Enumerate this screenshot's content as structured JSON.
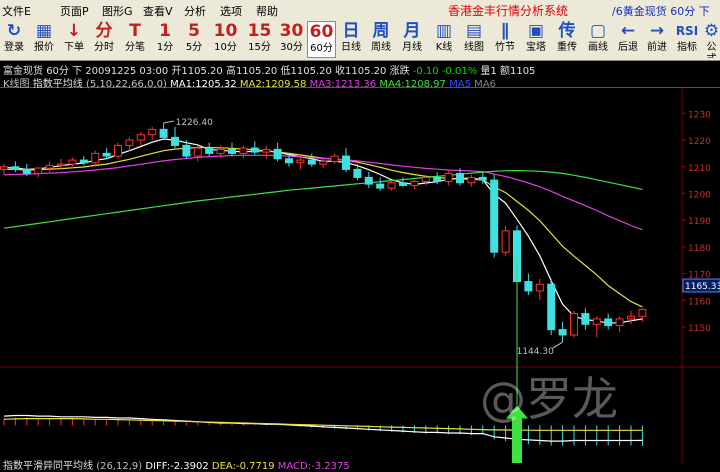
{
  "menu": {
    "items": [
      "文件E",
      "页面P",
      "图形G",
      "查看V",
      "分析",
      "选项",
      "帮助"
    ],
    "title": "香港金丰行情分析系统",
    "sub": "/6黄金现货 60分 下"
  },
  "toolbar": {
    "buttons": [
      {
        "glyph": "↻",
        "label": "登录"
      },
      {
        "glyph": "▦",
        "label": "报价"
      },
      {
        "glyph": "↓",
        "label": "下单"
      },
      {
        "glyph": "分",
        "label": "分时"
      },
      {
        "glyph": "T",
        "label": "分笔"
      },
      {
        "glyph": "1",
        "label": "1分"
      },
      {
        "glyph": "5",
        "label": "5分"
      },
      {
        "glyph": "10",
        "label": "10分"
      },
      {
        "glyph": "15",
        "label": "15分"
      },
      {
        "glyph": "30",
        "label": "30分"
      },
      {
        "glyph": "60",
        "label": "60分"
      },
      {
        "glyph": "日",
        "label": "日线"
      },
      {
        "glyph": "周",
        "label": "周线"
      },
      {
        "glyph": "月",
        "label": "月线"
      },
      {
        "glyph": "▥",
        "label": "K线"
      },
      {
        "glyph": "▤",
        "label": "线图"
      },
      {
        "glyph": "∥",
        "label": "竹节"
      },
      {
        "glyph": "▣",
        "label": "宝塔"
      },
      {
        "glyph": "传",
        "label": "重传"
      },
      {
        "glyph": "▢",
        "label": "画线"
      },
      {
        "glyph": "←",
        "label": "后退"
      },
      {
        "glyph": "→",
        "label": "前进"
      },
      {
        "glyph": "RSI",
        "label": "指标"
      },
      {
        "glyph": "⚙",
        "label": "公式"
      }
    ],
    "active_index": 10
  },
  "quote": {
    "symbol": "富金现货",
    "period": "60分",
    "direction": "下",
    "datetime": "20091225 03:00",
    "open_label": "开",
    "open": "1105.20",
    "high_label": "高",
    "high": "1105.20",
    "low_label": "低",
    "low": "1105.20",
    "close_label": "收",
    "close": "1105.20",
    "change_label": "涨跌",
    "change": "-0.10",
    "pct": "-0.01%",
    "vol_label": "量",
    "vol": "1",
    "amount_label": "额",
    "amount": "1105"
  },
  "ma_header": {
    "tab": "K线图",
    "indicator": "指数平均线",
    "params": "(5,10,22,66,0,0)",
    "ma1": "MA1:1205.32",
    "ma2": "MA2:1209.58",
    "ma3": "MA3:1213.36",
    "ma4": "MA4:1208.97",
    "ma5": "MA5",
    "ma6": "MA6"
  },
  "macd_header": {
    "name": "指数平滑异同平均线",
    "params": "(26,12,9)",
    "diff": "DIFF:-2.3902",
    "dea": "DEA:-0.7719",
    "macd": "MACD:-3.2375"
  },
  "colors": {
    "ma1": "#ffffff",
    "ma2": "#e8e040",
    "ma3": "#e040e0",
    "ma4": "#40e040",
    "ma5": "#0000ff",
    "ma6": "#808080",
    "candle_up": "#ff3030",
    "candle_down": "#40e0e0",
    "diff": "#ffffff",
    "dea": "#e8e040",
    "macd": "#e040e0"
  },
  "chart_data": {
    "type": "line",
    "title": "",
    "xlabel": "",
    "ylabel": "",
    "ylim": [
      1135,
      1235
    ],
    "y_ticks": [
      "1230",
      "1220",
      "1210",
      "1200",
      "1190",
      "1180",
      "1170",
      "1160",
      "1150"
    ],
    "last_price_label": "1165.33",
    "annotations": [
      "1226.40",
      "1144.30"
    ],
    "candles": [
      {
        "o": 1209.0,
        "h": 1211.0,
        "l": 1207.0,
        "c": 1210.0
      },
      {
        "o": 1210.0,
        "h": 1212.0,
        "l": 1208.0,
        "c": 1209.0
      },
      {
        "o": 1209.0,
        "h": 1211.0,
        "l": 1206.5,
        "c": 1207.5
      },
      {
        "o": 1207.5,
        "h": 1210.0,
        "l": 1206.0,
        "c": 1209.5
      },
      {
        "o": 1209.5,
        "h": 1212.0,
        "l": 1208.0,
        "c": 1210.5
      },
      {
        "o": 1210.5,
        "h": 1213.0,
        "l": 1209.0,
        "c": 1211.0
      },
      {
        "o": 1211.0,
        "h": 1213.5,
        "l": 1209.5,
        "c": 1212.5
      },
      {
        "o": 1212.5,
        "h": 1214.0,
        "l": 1210.5,
        "c": 1211.5
      },
      {
        "o": 1211.5,
        "h": 1216.0,
        "l": 1210.0,
        "c": 1215.0
      },
      {
        "o": 1215.0,
        "h": 1217.0,
        "l": 1213.0,
        "c": 1214.0
      },
      {
        "o": 1214.0,
        "h": 1219.0,
        "l": 1213.0,
        "c": 1218.0
      },
      {
        "o": 1218.0,
        "h": 1221.0,
        "l": 1216.0,
        "c": 1220.0
      },
      {
        "o": 1220.0,
        "h": 1223.0,
        "l": 1218.0,
        "c": 1222.0
      },
      {
        "o": 1222.0,
        "h": 1225.0,
        "l": 1220.0,
        "c": 1224.0
      },
      {
        "o": 1224.0,
        "h": 1226.4,
        "l": 1220.0,
        "c": 1221.0
      },
      {
        "o": 1221.0,
        "h": 1225.0,
        "l": 1217.0,
        "c": 1218.0
      },
      {
        "o": 1218.0,
        "h": 1220.0,
        "l": 1213.0,
        "c": 1214.0
      },
      {
        "o": 1214.0,
        "h": 1218.0,
        "l": 1212.0,
        "c": 1217.0
      },
      {
        "o": 1217.0,
        "h": 1219.0,
        "l": 1214.0,
        "c": 1215.0
      },
      {
        "o": 1215.0,
        "h": 1218.0,
        "l": 1213.5,
        "c": 1216.5
      },
      {
        "o": 1216.5,
        "h": 1219.0,
        "l": 1214.0,
        "c": 1215.0
      },
      {
        "o": 1215.0,
        "h": 1218.0,
        "l": 1213.0,
        "c": 1217.0
      },
      {
        "o": 1217.0,
        "h": 1219.5,
        "l": 1214.5,
        "c": 1215.5
      },
      {
        "o": 1215.5,
        "h": 1218.0,
        "l": 1213.0,
        "c": 1216.5
      },
      {
        "o": 1216.5,
        "h": 1219.0,
        "l": 1212.0,
        "c": 1213.0
      },
      {
        "o": 1213.0,
        "h": 1215.0,
        "l": 1210.0,
        "c": 1211.5
      },
      {
        "o": 1211.5,
        "h": 1214.0,
        "l": 1209.0,
        "c": 1212.5
      },
      {
        "o": 1212.5,
        "h": 1215.0,
        "l": 1210.0,
        "c": 1211.0
      },
      {
        "o": 1211.0,
        "h": 1213.0,
        "l": 1209.5,
        "c": 1212.0
      },
      {
        "o": 1212.0,
        "h": 1215.0,
        "l": 1211.0,
        "c": 1214.0
      },
      {
        "o": 1214.0,
        "h": 1217.0,
        "l": 1208.0,
        "c": 1209.0
      },
      {
        "o": 1209.0,
        "h": 1211.0,
        "l": 1205.0,
        "c": 1206.0
      },
      {
        "o": 1206.0,
        "h": 1208.0,
        "l": 1202.0,
        "c": 1203.5
      },
      {
        "o": 1203.5,
        "h": 1206.0,
        "l": 1201.0,
        "c": 1202.0
      },
      {
        "o": 1202.0,
        "h": 1205.0,
        "l": 1201.0,
        "c": 1204.0
      },
      {
        "o": 1204.0,
        "h": 1206.0,
        "l": 1202.5,
        "c": 1203.0
      },
      {
        "o": 1203.0,
        "h": 1205.0,
        "l": 1201.5,
        "c": 1204.5
      },
      {
        "o": 1204.5,
        "h": 1207.0,
        "l": 1203.0,
        "c": 1206.0
      },
      {
        "o": 1206.0,
        "h": 1208.0,
        "l": 1203.5,
        "c": 1204.5
      },
      {
        "o": 1204.5,
        "h": 1209.0,
        "l": 1203.0,
        "c": 1207.5
      },
      {
        "o": 1207.5,
        "h": 1209.5,
        "l": 1203.0,
        "c": 1204.0
      },
      {
        "o": 1204.0,
        "h": 1207.0,
        "l": 1202.5,
        "c": 1206.0
      },
      {
        "o": 1206.0,
        "h": 1208.0,
        "l": 1203.5,
        "c": 1205.0
      },
      {
        "o": 1205.0,
        "h": 1207.0,
        "l": 1176.0,
        "c": 1178.0
      },
      {
        "o": 1178.0,
        "h": 1188.0,
        "l": 1176.5,
        "c": 1186.0
      },
      {
        "o": 1186.0,
        "h": 1188.0,
        "l": 1165.0,
        "c": 1167.0
      },
      {
        "o": 1167.0,
        "h": 1170.0,
        "l": 1162.0,
        "c": 1163.5
      },
      {
        "o": 1163.5,
        "h": 1168.0,
        "l": 1160.0,
        "c": 1166.0
      },
      {
        "o": 1166.0,
        "h": 1168.0,
        "l": 1147.0,
        "c": 1149.0
      },
      {
        "o": 1149.0,
        "h": 1152.0,
        "l": 1144.3,
        "c": 1147.0
      },
      {
        "o": 1147.0,
        "h": 1156.0,
        "l": 1146.0,
        "c": 1155.0
      },
      {
        "o": 1155.0,
        "h": 1157.0,
        "l": 1149.0,
        "c": 1151.0
      },
      {
        "o": 1151.0,
        "h": 1154.0,
        "l": 1146.0,
        "c": 1153.0
      },
      {
        "o": 1153.0,
        "h": 1155.0,
        "l": 1149.0,
        "c": 1150.5
      },
      {
        "o": 1150.5,
        "h": 1154.0,
        "l": 1148.0,
        "c": 1153.0
      },
      {
        "o": 1153.0,
        "h": 1156.0,
        "l": 1151.0,
        "c": 1154.0
      },
      {
        "o": 1154.0,
        "h": 1157.0,
        "l": 1152.0,
        "c": 1156.5
      }
    ],
    "series": [
      {
        "name": "MA1",
        "values": [
          1209.8,
          1209.5,
          1209.0,
          1209.2,
          1209.8,
          1210.4,
          1211.0,
          1211.4,
          1212.4,
          1213.0,
          1214.6,
          1216.0,
          1217.6,
          1219.2,
          1220.4,
          1220.0,
          1219.0,
          1218.2,
          1216.4,
          1216.2,
          1215.8,
          1215.6,
          1215.8,
          1216.1,
          1215.4,
          1214.6,
          1213.7,
          1213.0,
          1212.0,
          1212.1,
          1211.6,
          1210.4,
          1208.9,
          1207.1,
          1205.1,
          1204.0,
          1203.4,
          1203.9,
          1204.4,
          1205.3,
          1205.6,
          1205.7,
          1205.2,
          1199.6,
          1196.4,
          1190.3,
          1184.0,
          1176.7,
          1167.3,
          1158.5,
          1154.0,
          1152.7,
          1152.3,
          1151.4,
          1151.6,
          1152.3,
          1153.0
        ]
      },
      {
        "name": "MA2",
        "values": [
          1209.0,
          1209.0,
          1208.8,
          1208.9,
          1209.1,
          1209.3,
          1209.6,
          1209.9,
          1210.5,
          1211.0,
          1211.9,
          1212.8,
          1213.9,
          1215.0,
          1216.0,
          1216.6,
          1216.9,
          1217.2,
          1217.2,
          1217.1,
          1216.9,
          1216.6,
          1216.3,
          1215.9,
          1215.5,
          1215.0,
          1214.4,
          1213.8,
          1213.2,
          1212.9,
          1212.4,
          1211.7,
          1210.8,
          1209.8,
          1208.7,
          1207.8,
          1207.1,
          1206.4,
          1206.0,
          1205.6,
          1205.5,
          1205.3,
          1205.1,
          1202.4,
          1200.3,
          1197.0,
          1193.7,
          1189.8,
          1185.0,
          1180.2,
          1176.5,
          1173.0,
          1169.5,
          1165.5,
          1162.5,
          1159.5,
          1157.5
        ]
      },
      {
        "name": "MA3",
        "values": [
          1207.0,
          1207.1,
          1207.2,
          1207.4,
          1207.6,
          1207.8,
          1208.1,
          1208.4,
          1208.8,
          1209.2,
          1209.7,
          1210.3,
          1210.9,
          1211.6,
          1212.2,
          1212.7,
          1213.1,
          1213.5,
          1213.8,
          1214.0,
          1214.2,
          1214.3,
          1214.3,
          1214.3,
          1214.2,
          1214.0,
          1213.7,
          1213.4,
          1213.1,
          1212.9,
          1212.6,
          1212.2,
          1211.7,
          1211.2,
          1210.7,
          1210.2,
          1209.8,
          1209.4,
          1209.1,
          1208.8,
          1208.6,
          1208.4,
          1208.2,
          1207.2,
          1206.4,
          1205.2,
          1203.9,
          1202.5,
          1200.8,
          1198.9,
          1197.2,
          1195.4,
          1193.6,
          1191.6,
          1189.8,
          1188.0,
          1186.4
        ]
      },
      {
        "name": "MA4",
        "values": [
          1187.0,
          1187.6,
          1188.2,
          1188.8,
          1189.4,
          1190.0,
          1190.6,
          1191.2,
          1191.8,
          1192.4,
          1193.0,
          1193.6,
          1194.2,
          1194.8,
          1195.4,
          1196.0,
          1196.6,
          1197.2,
          1197.7,
          1198.2,
          1198.7,
          1199.2,
          1199.7,
          1200.2,
          1200.7,
          1201.2,
          1201.6,
          1202.0,
          1202.4,
          1202.8,
          1203.2,
          1203.6,
          1204.0,
          1204.4,
          1204.8,
          1205.2,
          1205.6,
          1206.0,
          1206.4,
          1206.8,
          1207.2,
          1207.6,
          1208.0,
          1208.3,
          1208.5,
          1208.6,
          1208.5,
          1208.3,
          1208.0,
          1207.5,
          1206.8,
          1206.0,
          1205.1,
          1204.2,
          1203.3,
          1202.4,
          1201.5
        ]
      }
    ],
    "macd": {
      "ylim": [
        -6,
        6
      ],
      "diff": [
        1.5,
        1.6,
        1.6,
        1.5,
        1.5,
        1.4,
        1.4,
        1.4,
        1.3,
        1.3,
        1.2,
        1.2,
        1.1,
        1.0,
        0.9,
        0.8,
        0.7,
        0.6,
        0.5,
        0.4,
        0.4,
        0.3,
        0.3,
        0.2,
        0.2,
        0.1,
        0.0,
        -0.1,
        -0.2,
        -0.3,
        -0.4,
        -0.5,
        -0.6,
        -0.7,
        -0.8,
        -0.9,
        -1.0,
        -1.1,
        -1.1,
        -1.2,
        -1.2,
        -1.3,
        -1.3,
        -1.8,
        -2.0,
        -2.2,
        -2.3,
        -2.4,
        -2.5,
        -2.5,
        -2.4,
        -2.4,
        -2.4,
        -2.4,
        -2.4,
        -2.4,
        -2.39
      ],
      "dea": [
        1.0,
        1.05,
        1.1,
        1.1,
        1.1,
        1.1,
        1.1,
        1.05,
        1.0,
        1.0,
        0.95,
        0.9,
        0.85,
        0.8,
        0.75,
        0.7,
        0.65,
        0.6,
        0.55,
        0.5,
        0.45,
        0.4,
        0.35,
        0.3,
        0.25,
        0.2,
        0.15,
        0.1,
        0.05,
        0.0,
        -0.05,
        -0.1,
        -0.15,
        -0.2,
        -0.25,
        -0.3,
        -0.35,
        -0.4,
        -0.45,
        -0.5,
        -0.55,
        -0.6,
        -0.65,
        -0.7,
        -0.72,
        -0.74,
        -0.75,
        -0.76,
        -0.77,
        -0.77,
        -0.77,
        -0.77,
        -0.77,
        -0.77,
        -0.77,
        -0.77,
        -0.77
      ],
      "hist": [
        1.2,
        1.3,
        1.3,
        1.2,
        1.2,
        1.1,
        1.1,
        1.0,
        1.0,
        0.9,
        0.9,
        0.8,
        0.8,
        0.7,
        0.6,
        0.6,
        0.5,
        0.4,
        0.4,
        0.3,
        0.3,
        0.2,
        0.2,
        0.1,
        0.1,
        0.0,
        -0.2,
        -0.3,
        -0.4,
        -0.5,
        -0.6,
        -0.7,
        -0.8,
        -0.9,
        -1.0,
        -1.1,
        -1.2,
        -1.3,
        -1.3,
        -1.4,
        -1.4,
        -1.5,
        -1.5,
        -2.2,
        -2.5,
        -2.8,
        -3.0,
        -3.1,
        -3.2,
        -3.2,
        -3.2,
        -3.2,
        -3.2,
        -3.2,
        -3.2,
        -3.2,
        -3.24
      ]
    }
  },
  "watermark": "@罗龙"
}
